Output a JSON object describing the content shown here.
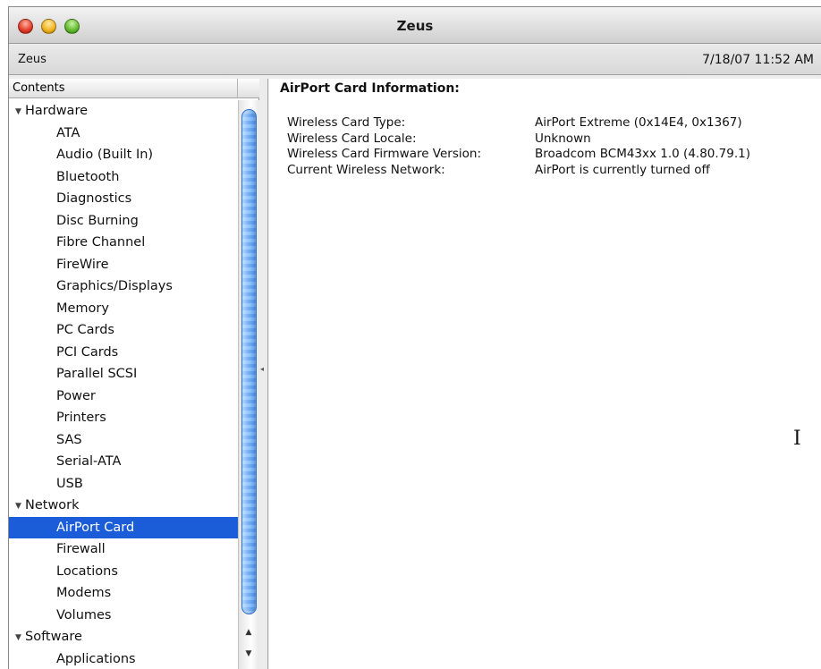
{
  "window": {
    "title": "Zeus"
  },
  "infobar": {
    "machine_name": "Zeus",
    "datetime": "7/18/07 11:52 AM"
  },
  "sidebar": {
    "column_header": "Contents",
    "groups": [
      {
        "label": "Hardware",
        "items": [
          "ATA",
          "Audio (Built In)",
          "Bluetooth",
          "Diagnostics",
          "Disc Burning",
          "Fibre Channel",
          "FireWire",
          "Graphics/Displays",
          "Memory",
          "PC Cards",
          "PCI Cards",
          "Parallel SCSI",
          "Power",
          "Printers",
          "SAS",
          "Serial-ATA",
          "USB"
        ]
      },
      {
        "label": "Network",
        "items": [
          "AirPort Card",
          "Firewall",
          "Locations",
          "Modems",
          "Volumes"
        ]
      },
      {
        "label": "Software",
        "items": [
          "Applications"
        ]
      }
    ],
    "selected_item": "AirPort Card"
  },
  "detail": {
    "title": "AirPort Card Information:",
    "rows": [
      {
        "key": "Wireless Card Type:",
        "value": "AirPort Extreme  (0x14E4, 0x1367)"
      },
      {
        "key": "Wireless Card Locale:",
        "value": "Unknown"
      },
      {
        "key": "Wireless Card Firmware Version:",
        "value": "Broadcom BCM43xx 1.0 (4.80.79.1)"
      },
      {
        "key": "Current Wireless Network:",
        "value": "AirPort is currently turned off"
      }
    ]
  },
  "icons": {
    "close": "close-button",
    "minimize": "minimize-button",
    "zoom": "zoom-button",
    "disclosure": "disclosure-triangle-icon",
    "text_cursor": "i-beam-cursor-icon"
  },
  "colors": {
    "selection": "#1b5cd8",
    "scroll_thumb": "#6aaaf5"
  }
}
